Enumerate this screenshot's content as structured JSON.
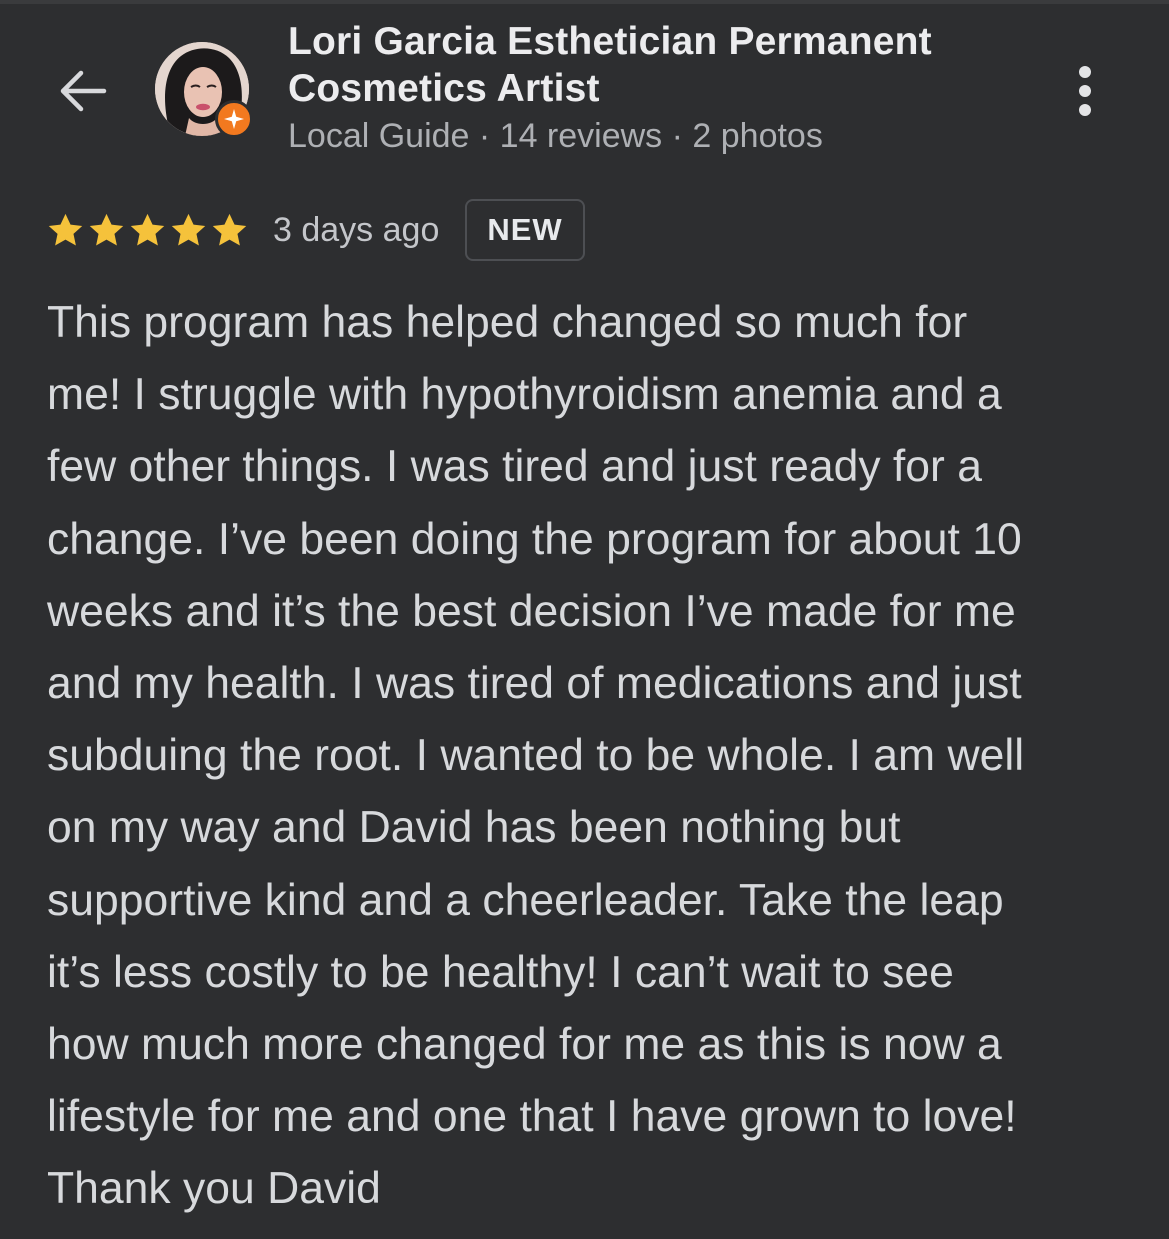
{
  "colors": {
    "background": "#2d2e30",
    "star": "#f5c23b",
    "local_guide_badge": "#f2791f"
  },
  "icons": {
    "back": "arrow-left-icon",
    "more": "more-vertical-icon",
    "star": "star-icon",
    "local_guide": "local-guide-badge-icon"
  },
  "header": {
    "author_name": "Lori Garcia Esthetician Permanent Cosmetics Artist",
    "author_meta": "Local Guide · 14 reviews · 2 photos"
  },
  "review": {
    "rating": 5,
    "rating_max": 5,
    "date": "3 days ago",
    "badge": "NEW",
    "lines": [
      "This program has helped changed so much for",
      "me! I struggle with hypothyroidism anemia and a",
      "few other things. I was tired and just ready for a",
      "change. I’ve been doing the program for about 10",
      "weeks and it’s the best decision I’ve made for me",
      "and my health. I was tired of medications and just",
      "subduing the root. I wanted to be whole. I am well",
      "on my way and David has been nothing but",
      "supportive kind and a cheerleader. Take the leap",
      "it’s less costly to be healthy! I can’t wait to see",
      "how much more changed for me as this is now a",
      "lifestyle for me and one that I have grown to love!",
      "Thank you David"
    ]
  }
}
